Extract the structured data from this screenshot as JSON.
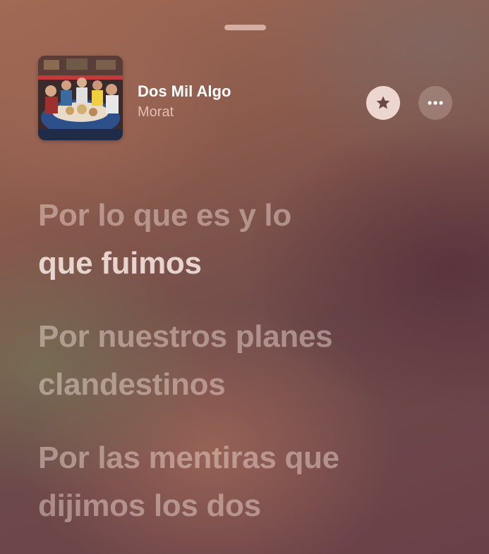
{
  "sheet": {
    "grabber_icon": "drag-handle"
  },
  "now_playing": {
    "title": "Dos Mil Algo",
    "artist": "Morat",
    "favorite_icon": "star-icon",
    "more_icon": "ellipsis-icon"
  },
  "lyrics": [
    {
      "line1": "Por lo que es y lo",
      "line2": "que fuimos",
      "state": "active"
    },
    {
      "line1": "Por nuestros planes",
      "line2": "clandestinos",
      "state": "upcoming"
    },
    {
      "line1": "Por las mentiras que",
      "line2": "dijimos los dos",
      "state": "upcoming"
    }
  ],
  "colors": {
    "text_primary": "#ffffff",
    "lyric_dim": "rgba(255,235,228,0.42)",
    "lyric_active": "rgba(255,240,235,0.82)",
    "star_button_bg": "#f5e1da",
    "star_glyph": "#6b4a44"
  }
}
